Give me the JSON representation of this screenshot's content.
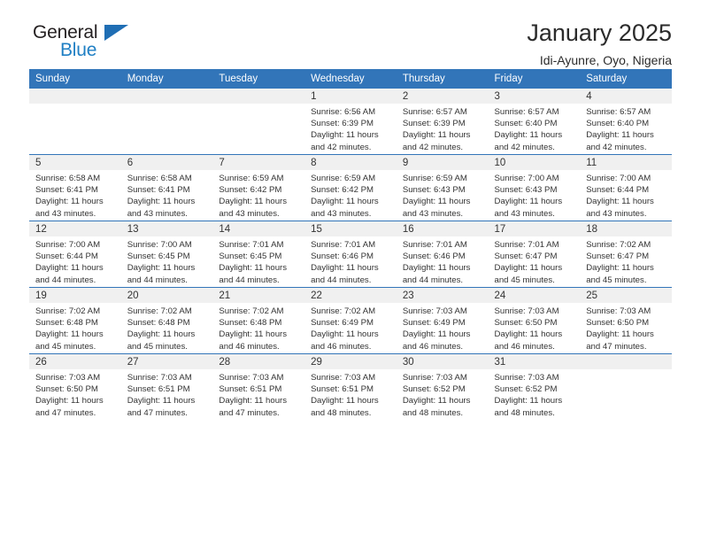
{
  "brand": {
    "name_top": "General",
    "name_bottom": "Blue",
    "accent_color": "#1f6eb4",
    "logo_icon": "triangle-flag-icon"
  },
  "header": {
    "title": "January 2025",
    "location": "Idi-Ayunre, Oyo, Nigeria"
  },
  "theme": {
    "header_row_bg": "#3275b9",
    "daynum_bg": "#f0f0f0",
    "text_color": "#333333",
    "page_bg": "#ffffff"
  },
  "weekday_headers": [
    "Sunday",
    "Monday",
    "Tuesday",
    "Wednesday",
    "Thursday",
    "Friday",
    "Saturday"
  ],
  "weeks": [
    [
      {
        "day": "",
        "empty": true,
        "sunrise": "",
        "sunset": "",
        "daylight_line1": "",
        "daylight_line2": ""
      },
      {
        "day": "",
        "empty": true,
        "sunrise": "",
        "sunset": "",
        "daylight_line1": "",
        "daylight_line2": ""
      },
      {
        "day": "",
        "empty": true,
        "sunrise": "",
        "sunset": "",
        "daylight_line1": "",
        "daylight_line2": ""
      },
      {
        "day": "1",
        "empty": false,
        "sunrise": "Sunrise: 6:56 AM",
        "sunset": "Sunset: 6:39 PM",
        "daylight_line1": "Daylight: 11 hours",
        "daylight_line2": "and 42 minutes."
      },
      {
        "day": "2",
        "empty": false,
        "sunrise": "Sunrise: 6:57 AM",
        "sunset": "Sunset: 6:39 PM",
        "daylight_line1": "Daylight: 11 hours",
        "daylight_line2": "and 42 minutes."
      },
      {
        "day": "3",
        "empty": false,
        "sunrise": "Sunrise: 6:57 AM",
        "sunset": "Sunset: 6:40 PM",
        "daylight_line1": "Daylight: 11 hours",
        "daylight_line2": "and 42 minutes."
      },
      {
        "day": "4",
        "empty": false,
        "sunrise": "Sunrise: 6:57 AM",
        "sunset": "Sunset: 6:40 PM",
        "daylight_line1": "Daylight: 11 hours",
        "daylight_line2": "and 42 minutes."
      }
    ],
    [
      {
        "day": "5",
        "empty": false,
        "sunrise": "Sunrise: 6:58 AM",
        "sunset": "Sunset: 6:41 PM",
        "daylight_line1": "Daylight: 11 hours",
        "daylight_line2": "and 43 minutes."
      },
      {
        "day": "6",
        "empty": false,
        "sunrise": "Sunrise: 6:58 AM",
        "sunset": "Sunset: 6:41 PM",
        "daylight_line1": "Daylight: 11 hours",
        "daylight_line2": "and 43 minutes."
      },
      {
        "day": "7",
        "empty": false,
        "sunrise": "Sunrise: 6:59 AM",
        "sunset": "Sunset: 6:42 PM",
        "daylight_line1": "Daylight: 11 hours",
        "daylight_line2": "and 43 minutes."
      },
      {
        "day": "8",
        "empty": false,
        "sunrise": "Sunrise: 6:59 AM",
        "sunset": "Sunset: 6:42 PM",
        "daylight_line1": "Daylight: 11 hours",
        "daylight_line2": "and 43 minutes."
      },
      {
        "day": "9",
        "empty": false,
        "sunrise": "Sunrise: 6:59 AM",
        "sunset": "Sunset: 6:43 PM",
        "daylight_line1": "Daylight: 11 hours",
        "daylight_line2": "and 43 minutes."
      },
      {
        "day": "10",
        "empty": false,
        "sunrise": "Sunrise: 7:00 AM",
        "sunset": "Sunset: 6:43 PM",
        "daylight_line1": "Daylight: 11 hours",
        "daylight_line2": "and 43 minutes."
      },
      {
        "day": "11",
        "empty": false,
        "sunrise": "Sunrise: 7:00 AM",
        "sunset": "Sunset: 6:44 PM",
        "daylight_line1": "Daylight: 11 hours",
        "daylight_line2": "and 43 minutes."
      }
    ],
    [
      {
        "day": "12",
        "empty": false,
        "sunrise": "Sunrise: 7:00 AM",
        "sunset": "Sunset: 6:44 PM",
        "daylight_line1": "Daylight: 11 hours",
        "daylight_line2": "and 44 minutes."
      },
      {
        "day": "13",
        "empty": false,
        "sunrise": "Sunrise: 7:00 AM",
        "sunset": "Sunset: 6:45 PM",
        "daylight_line1": "Daylight: 11 hours",
        "daylight_line2": "and 44 minutes."
      },
      {
        "day": "14",
        "empty": false,
        "sunrise": "Sunrise: 7:01 AM",
        "sunset": "Sunset: 6:45 PM",
        "daylight_line1": "Daylight: 11 hours",
        "daylight_line2": "and 44 minutes."
      },
      {
        "day": "15",
        "empty": false,
        "sunrise": "Sunrise: 7:01 AM",
        "sunset": "Sunset: 6:46 PM",
        "daylight_line1": "Daylight: 11 hours",
        "daylight_line2": "and 44 minutes."
      },
      {
        "day": "16",
        "empty": false,
        "sunrise": "Sunrise: 7:01 AM",
        "sunset": "Sunset: 6:46 PM",
        "daylight_line1": "Daylight: 11 hours",
        "daylight_line2": "and 44 minutes."
      },
      {
        "day": "17",
        "empty": false,
        "sunrise": "Sunrise: 7:01 AM",
        "sunset": "Sunset: 6:47 PM",
        "daylight_line1": "Daylight: 11 hours",
        "daylight_line2": "and 45 minutes."
      },
      {
        "day": "18",
        "empty": false,
        "sunrise": "Sunrise: 7:02 AM",
        "sunset": "Sunset: 6:47 PM",
        "daylight_line1": "Daylight: 11 hours",
        "daylight_line2": "and 45 minutes."
      }
    ],
    [
      {
        "day": "19",
        "empty": false,
        "sunrise": "Sunrise: 7:02 AM",
        "sunset": "Sunset: 6:48 PM",
        "daylight_line1": "Daylight: 11 hours",
        "daylight_line2": "and 45 minutes."
      },
      {
        "day": "20",
        "empty": false,
        "sunrise": "Sunrise: 7:02 AM",
        "sunset": "Sunset: 6:48 PM",
        "daylight_line1": "Daylight: 11 hours",
        "daylight_line2": "and 45 minutes."
      },
      {
        "day": "21",
        "empty": false,
        "sunrise": "Sunrise: 7:02 AM",
        "sunset": "Sunset: 6:48 PM",
        "daylight_line1": "Daylight: 11 hours",
        "daylight_line2": "and 46 minutes."
      },
      {
        "day": "22",
        "empty": false,
        "sunrise": "Sunrise: 7:02 AM",
        "sunset": "Sunset: 6:49 PM",
        "daylight_line1": "Daylight: 11 hours",
        "daylight_line2": "and 46 minutes."
      },
      {
        "day": "23",
        "empty": false,
        "sunrise": "Sunrise: 7:03 AM",
        "sunset": "Sunset: 6:49 PM",
        "daylight_line1": "Daylight: 11 hours",
        "daylight_line2": "and 46 minutes."
      },
      {
        "day": "24",
        "empty": false,
        "sunrise": "Sunrise: 7:03 AM",
        "sunset": "Sunset: 6:50 PM",
        "daylight_line1": "Daylight: 11 hours",
        "daylight_line2": "and 46 minutes."
      },
      {
        "day": "25",
        "empty": false,
        "sunrise": "Sunrise: 7:03 AM",
        "sunset": "Sunset: 6:50 PM",
        "daylight_line1": "Daylight: 11 hours",
        "daylight_line2": "and 47 minutes."
      }
    ],
    [
      {
        "day": "26",
        "empty": false,
        "sunrise": "Sunrise: 7:03 AM",
        "sunset": "Sunset: 6:50 PM",
        "daylight_line1": "Daylight: 11 hours",
        "daylight_line2": "and 47 minutes."
      },
      {
        "day": "27",
        "empty": false,
        "sunrise": "Sunrise: 7:03 AM",
        "sunset": "Sunset: 6:51 PM",
        "daylight_line1": "Daylight: 11 hours",
        "daylight_line2": "and 47 minutes."
      },
      {
        "day": "28",
        "empty": false,
        "sunrise": "Sunrise: 7:03 AM",
        "sunset": "Sunset: 6:51 PM",
        "daylight_line1": "Daylight: 11 hours",
        "daylight_line2": "and 47 minutes."
      },
      {
        "day": "29",
        "empty": false,
        "sunrise": "Sunrise: 7:03 AM",
        "sunset": "Sunset: 6:51 PM",
        "daylight_line1": "Daylight: 11 hours",
        "daylight_line2": "and 48 minutes."
      },
      {
        "day": "30",
        "empty": false,
        "sunrise": "Sunrise: 7:03 AM",
        "sunset": "Sunset: 6:52 PM",
        "daylight_line1": "Daylight: 11 hours",
        "daylight_line2": "and 48 minutes."
      },
      {
        "day": "31",
        "empty": false,
        "sunrise": "Sunrise: 7:03 AM",
        "sunset": "Sunset: 6:52 PM",
        "daylight_line1": "Daylight: 11 hours",
        "daylight_line2": "and 48 minutes."
      },
      {
        "day": "",
        "empty": true,
        "sunrise": "",
        "sunset": "",
        "daylight_line1": "",
        "daylight_line2": ""
      }
    ]
  ]
}
